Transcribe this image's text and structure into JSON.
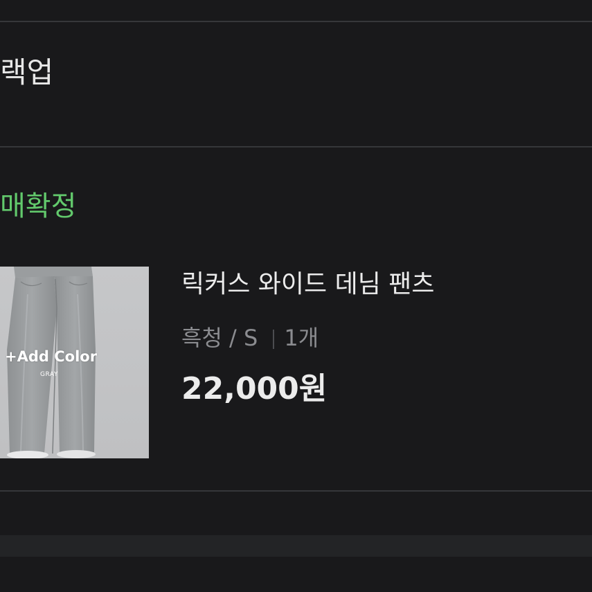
{
  "order": {
    "store_name": "랙업",
    "status": "매확정"
  },
  "product": {
    "name": "릭커스 와이드 데님 팬츠",
    "option": "흑청 / S",
    "quantity": "1개",
    "price": "22,000원",
    "thumbnail": {
      "overlay_title": "+Add Color",
      "overlay_subtitle": "GRAY"
    }
  },
  "colors": {
    "background": "#19191b",
    "divider": "#36373a",
    "status_green": "#62c96c",
    "text_primary": "#ececec",
    "text_secondary": "#8b8c90"
  }
}
